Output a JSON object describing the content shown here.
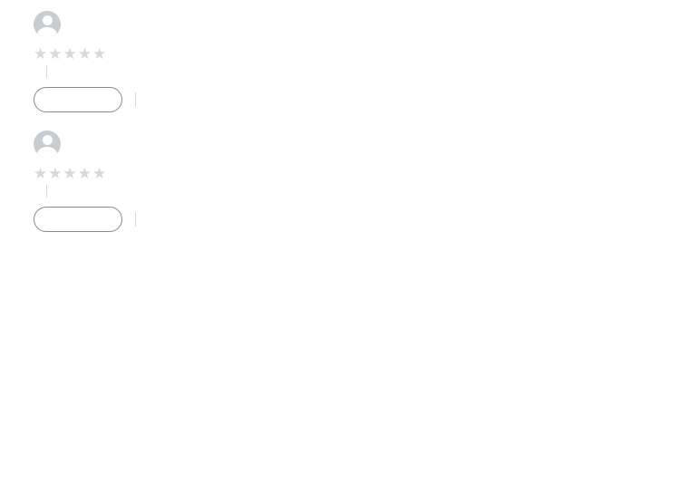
{
  "colors": {
    "star": "#de7921",
    "verified": "#c45500",
    "muted_text": "#565959"
  },
  "icons": {
    "avatar": "user-silhouette-icon",
    "star": "star-icon",
    "review_image": "photo-thumbnail"
  },
  "reviews": [
    {
      "reviewer_name": "",
      "rating": 0,
      "rating_max": 5,
      "headline": "",
      "reviewed_in": "",
      "variant": "",
      "verified": "",
      "body_lines": [
        "",
        "",
        ""
      ],
      "has_image": false,
      "helpful_count_text": "",
      "helpful_label": "",
      "report_label": ""
    },
    {
      "reviewer_name": "",
      "rating": 0,
      "rating_max": 5,
      "headline": "",
      "reviewed_in": "",
      "variant": "",
      "verified": "",
      "body_lines": [
        ""
      ],
      "has_image": false,
      "helpful_count_text": "",
      "helpful_label": "",
      "report_label": ""
    }
  ]
}
